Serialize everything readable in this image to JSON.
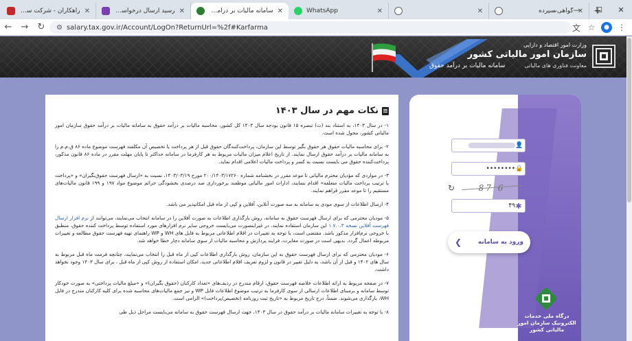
{
  "browser": {
    "tabs": [
      {
        "title": "راهکاران - شرکت سپیدار سیستم آسیا",
        "favicon_color": "#c62828",
        "active": false
      },
      {
        "title": "رسید ارسال درخواست به کاربوی...",
        "favicon_color": "#7b3fb3",
        "active": false
      },
      {
        "title": "سامانه مالیات بر درآمد حقوق",
        "favicon_color": "#2e7d32",
        "active": true
      },
      {
        "title": "WhatsApp",
        "favicon_color": "#25d366",
        "active": false
      },
      {
        "title": "",
        "favicon_color": "#5f6368",
        "active": false
      },
      {
        "title": "گواهی سپرده",
        "favicon_color": "#5f6368",
        "active": false
      }
    ],
    "new_tab": "+",
    "url": "salary.tax.gov.ir/Account/LogOn?ReturnUrl=%2f#Karfarma"
  },
  "header": {
    "org_small": "وزارت امور اقتصاد و دارایی",
    "org_title": "سازمان امور مالیاتی کشور",
    "org_sub": "معاونت فناوری های مالیاتی",
    "system_title": "سامانه مالیات بر درآمد حقوق",
    "colors": {
      "bg": "#262626",
      "check": "#3c7ad6"
    }
  },
  "notice": {
    "title": "نکات مهم در سال ۱۴۰۳",
    "paragraphs": [
      "۱- در سال ۱۴۰۳، به استناد بند (ث) تبصره ۱۵ قانون بودجه سال ۱۴۰۳ کل کشور، محاسبه مالیات بر درآمد حقوق به سامانه مالیات بر درآمد حقوق سازمان امور مالیاتی کشور، محول شده است.",
      "۲- برای محاسبه مالیات حقوق هر حقوق بگیر توسط این سازمان، پرداخت‌کنندگان حقوق قبل از هر پرداخت یا تخصیص آن مکلفند فهرست موضوع ماده ۸۶ ق.م.م را به سامانه مالیات بر درآمد حقوق ارسال نمایند. از تاریخ اعلام میزان مالیات مربوط به هر کارفرما در سامانه حداکثر تا پایان مهلت مقرر در ماده ۸۶ قانون مذکور، پرداخت‌کننده حقوق می بایست نسبت به کسر و پرداخت مالیات اعلامی اقدام نماید.",
      "۳- در مواردی که مؤدیان محترم مالیاتی تا موعد مقرر در بخشنامه شماره ۲۰۰/۱۴۰۳/۱۷۲۶۰ مورخ ۱۴۰۳/۰۳/۱۹، نسبت به «ارسال فهرست حقوق‌بگیران» و «پرداخت یا ترتیب پرداخت مالیات متعلقه» اقدام ننمایند، ادارات امور مالیاتی موظفند برخورداری صد درصدی بخشودگی جرائم موضوع مواد ۱۹۷ و ۱۹۹ قانون مالیات‌های مستقیم را تا موعد مقرر فراهم نمایند.",
      "۴- ارسال اطلاعات از سوی مودی به سامانه به سه صورت آنلاین، آفلاین و کپی از ماه قبل امکانپذیر می باشد.",
      "۵- مودیان محترمی که برای ارسال فهرست حقوق به سامانه، روش بارگذاری اطلاعات به صورت آفلاین را در سامانه انتخاب می‌نمایند، می‌توانند از نرم افزار ارسال فهرست آفلاین نسخه ۱.۷.۰.۳ این سازمان استفاده نمایند. در غیراینصورت می‌بایست خروجی سایر نرم افزارهای مورد استفاده توسط پرداخت کننده حقوق، منطبق با خروجی نرم‌افزار مذکور باشد. مقتضی است، با توجه به تغییرات در اقلام اطلاعاتی مربوط به فایل های WH و WP راهنمای تهیه فهرست حقوق مطالعه و تغییرات مربوطه اعمال گردد. بدیهی است در صورت مغایرت، فرایند پردازش و محاسبه مالیات از سوی سامانه دچار خطا خواهد شد.",
      "۶- مودیان محترمی که برای ارسال فهرست حقوق به این سازمان، روش بارگذاری اطلاعات کپی از ماه قبل را انتخاب می‌نمایند، چنانچه فرمت ماه قبل مربوط به سال های ۱۴۰۲ و قبل از آن باشد، به دلیل تغییر در قانون و لزوم تعریف اقلام اطلاعاتی جدید، امکان استفاده از روش کپی از ماه قبل ، برای سال ۱۴۰۳ وجود نخواهد داشت.",
      "۷- در صفحه مربوط به ارائه اطلاعات خلاصه فهرست حقوق، ارقام مندرج در ردیف‌های «تعداد کارکنان (حقوق بگیران)» و «مبلغ مالیات پرداختی» به صورت خودکار توسط سامانه و برمبنای اطلاعات ارسالی از سوی کارفرما به ترتیب موضوع اطلاعات فایل WP و نیز جمع مالیات‌های محاسبه شده برای کلیه کارکنان مندرج در فایل WH، بارگذاری می‌شوند. ضمناً، درج تاریخ مربوط به «تاریخ ثبت روزنامه (تخصیص/پرداخت)» الزامی است.",
      "۸- با توجه به تغییرات سامانه مالیات بر درآمد حقوق در سال ۱۴۰۳، جهت ارسال فهرست حقوق به سامانه می‌بایست مراحل ذیل طی"
    ],
    "link_text": "نرم افزار ارسال فهرست آفلاین نسخه ۱.۷.۰.۳"
  },
  "login": {
    "username_value": "",
    "password_value": "••••••••",
    "captcha_text": "87 6",
    "captcha_input": "۴۹",
    "enter_label": "ورود به سامانه",
    "ecs_text": "درگاه ملی خدمات الکترونیک سازمان امور مالیاتی کشور",
    "colors": {
      "accent": "#6f5bb8",
      "page_bg": "#8f94c9"
    }
  }
}
